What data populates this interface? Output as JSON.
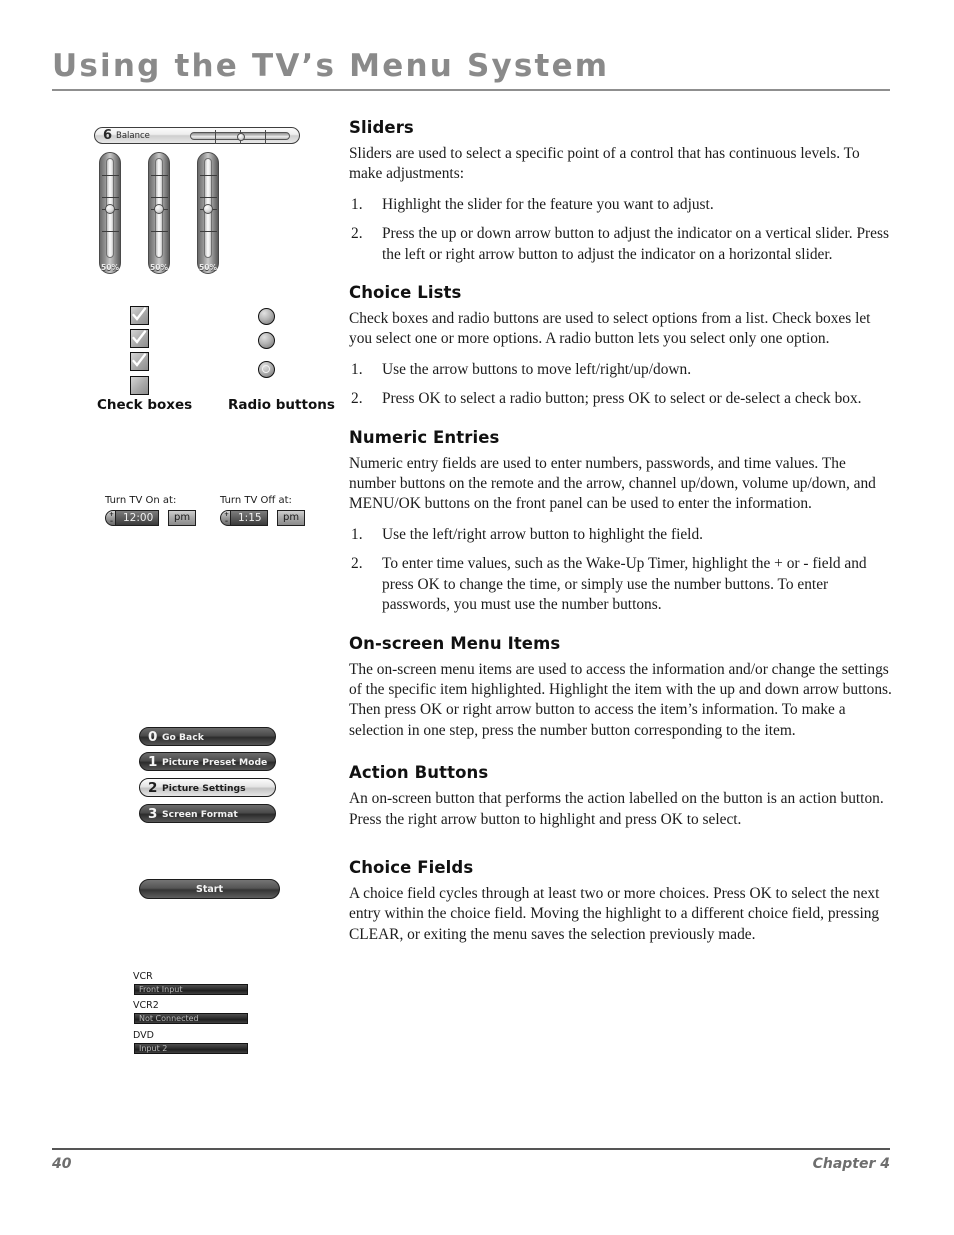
{
  "header": {
    "title": "Using the TV’s Menu System"
  },
  "footer": {
    "page_number": "40",
    "chapter": "Chapter 4"
  },
  "illustrations": {
    "horizontal_slider": {
      "number": "6",
      "label": "Balance"
    },
    "vertical_sliders": [
      {
        "value": "50%"
      },
      {
        "value": "50%"
      },
      {
        "value": "50%"
      }
    ],
    "check_boxes": {
      "caption": "Check boxes",
      "items": [
        {
          "checked": true
        },
        {
          "checked": true
        },
        {
          "checked": true
        },
        {
          "checked": false
        }
      ]
    },
    "radio_buttons": {
      "caption": "Radio buttons",
      "items": [
        {
          "selected": false
        },
        {
          "selected": false
        },
        {
          "selected": true
        }
      ]
    },
    "numeric_entries": [
      {
        "label": "Turn TV On at:",
        "value": "12:00",
        "meridiem": "pm",
        "stepper": "+−"
      },
      {
        "label": "Turn TV Off at:",
        "value": "1:15",
        "meridiem": "pm",
        "stepper": "+−"
      }
    ],
    "menu_items": [
      {
        "number": "0",
        "label": "Go Back",
        "highlighted": false
      },
      {
        "number": "1",
        "label": "Picture Preset Mode",
        "highlighted": false
      },
      {
        "number": "2",
        "label": "Picture Settings",
        "highlighted": true
      },
      {
        "number": "3",
        "label": "Screen Format",
        "highlighted": false
      }
    ],
    "action_button": {
      "label": "Start"
    },
    "choice_fields": [
      {
        "label": "VCR",
        "value": "Front Input"
      },
      {
        "label": "VCR2",
        "value": "Not Connected"
      },
      {
        "label": "DVD",
        "value": "Input 2"
      }
    ]
  },
  "sections": [
    {
      "heading": "Sliders",
      "body": "Sliders are used to select a specific point of a control that has continuous levels. To make adjustments:",
      "steps": [
        {
          "num": "1.",
          "text": "Highlight the slider for the feature you want to adjust."
        },
        {
          "num": "2.",
          "text": "Press the up or down arrow button to adjust the indicator on a vertical slider. Press the left or right arrow button to adjust the indicator on a horizontal slider."
        }
      ]
    },
    {
      "heading": "Choice Lists",
      "body": "Check boxes and radio buttons are used to select options from a list. Check boxes let you select one or more options. A radio button lets you select only one option.",
      "steps": [
        {
          "num": "1.",
          "text": "Use the arrow buttons to move left/right/up/down."
        },
        {
          "num": "2.",
          "text": "Press OK to select a radio button; press OK to select or de-select a check box."
        }
      ]
    },
    {
      "heading": "Numeric Entries",
      "body": "Numeric entry fields are used to enter numbers, passwords, and time values. The number buttons on the remote and the arrow, channel up/down, volume up/down, and MENU/OK buttons on the front panel can be used to enter the information.",
      "steps": [
        {
          "num": "1.",
          "text": "Use the left/right arrow button to highlight the field."
        },
        {
          "num": "2.",
          "text": "To enter time values, such as the Wake-Up Timer, highlight the + or - field and press OK to change the time, or simply use the number buttons. To enter passwords, you must use the number buttons."
        }
      ]
    },
    {
      "heading": "On-screen Menu Items",
      "body": "The on-screen menu items are used to access the information and/or change the settings of the specific item highlighted. Highlight the item with the up and down arrow buttons. Then press OK or right arrow button to access the item’s information. To make a selection in one step, press the number button corresponding to the item.",
      "steps": []
    },
    {
      "heading": "Action Buttons",
      "body": "An on-screen button that performs the action labelled on the button is an action button. Press the right arrow button to highlight and press OK to select.",
      "steps": []
    },
    {
      "heading": "Choice Fields",
      "body": "A choice field cycles through at least two or more choices. Press OK to select the next entry within the choice field. Moving the highlight to a different choice field, pressing CLEAR, or exiting the menu saves the selection previously made.",
      "steps": []
    }
  ]
}
